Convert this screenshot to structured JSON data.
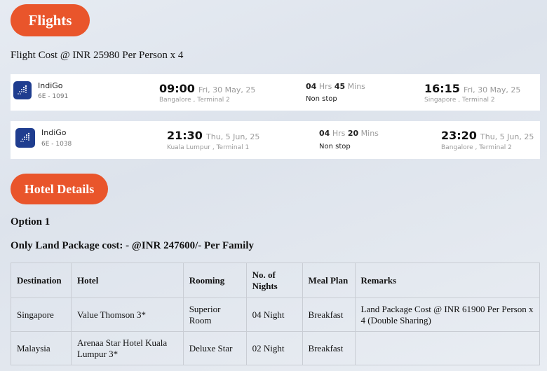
{
  "flights_section": {
    "title": "Flights",
    "cost_line": "Flight Cost @ INR 25980 Per Person x 4",
    "legs": [
      {
        "airline": "IndiGo",
        "flight_no": "6E - 1091",
        "dep_time": "09:00",
        "dep_date": "Fri, 30 May, 25",
        "dep_place": "Bangalore , Terminal 2",
        "dur_h": "04",
        "dur_h_unit": "Hrs",
        "dur_m": "45",
        "dur_m_unit": "Mins",
        "stops": "Non stop",
        "arr_time": "16:15",
        "arr_date": "Fri, 30 May, 25",
        "arr_place": "Singapore , Terminal 2"
      },
      {
        "airline": "IndiGo",
        "flight_no": "6E - 1038",
        "dep_time": "21:30",
        "dep_date": "Thu, 5 Jun, 25",
        "dep_place": "Kuala Lumpur , Terminal 1",
        "dur_h": "04",
        "dur_h_unit": "Hrs",
        "dur_m": "20",
        "dur_m_unit": "Mins",
        "stops": "Non stop",
        "arr_time": "23:20",
        "arr_date": "Thu, 5 Jun, 25",
        "arr_place": "Bangalore , Terminal 2"
      }
    ]
  },
  "hotel_section": {
    "title": "Hotel Details",
    "option_title": "Option 1",
    "package_cost": "Only Land Package cost: - @INR 247600/- Per Family",
    "headers": [
      "Destination",
      "Hotel",
      "Rooming",
      "No. of Nights",
      "Meal Plan",
      "Remarks"
    ],
    "rows": [
      [
        "Singapore",
        "Value Thomson 3*",
        "Superior Room",
        "04 Night",
        "Breakfast",
        "Land Package Cost @ INR 61900 Per Person x 4 (Double Sharing)"
      ],
      [
        "Malaysia",
        "Arenaa Star Hotel Kuala Lumpur 3*",
        "Deluxe Star",
        "02 Night",
        "Breakfast",
        ""
      ]
    ]
  },
  "colors": {
    "accent": "#e9552b",
    "logo": "#1f3d8f"
  }
}
